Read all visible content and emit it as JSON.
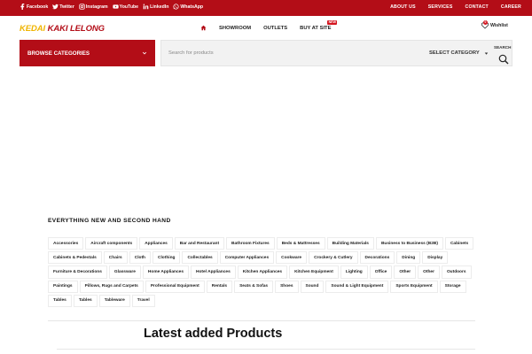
{
  "social": [
    {
      "label": "Facebook",
      "icon": "facebook-icon"
    },
    {
      "label": "Twitter",
      "icon": "twitter-icon"
    },
    {
      "label": "Instagram",
      "icon": "instagram-icon"
    },
    {
      "label": "YouTube",
      "icon": "youtube-icon"
    },
    {
      "label": "LinkedIn",
      "icon": "linkedin-icon"
    },
    {
      "label": "WhatsApp",
      "icon": "whatsapp-icon"
    }
  ],
  "top_links": [
    "ABOUT US",
    "SERVICES",
    "CONTACT",
    "CAREER"
  ],
  "logo": {
    "part1": "KEDAI",
    "part2": " KAKI LELONG"
  },
  "nav": {
    "showroom": "SHOWROOM",
    "outlets": "OUTLETS",
    "buy_at_site": "BUY AT SITE",
    "new_badge": "NEW"
  },
  "wishlist": {
    "label": "Wishlist",
    "count": "0"
  },
  "browse": {
    "label": "BROWSE CATEGORIES"
  },
  "search": {
    "placeholder": "Search for products",
    "category": "SELECT CATEGORY",
    "button_label": "SEARCH"
  },
  "section": {
    "heading": "EVERYTHING NEW AND SECOND HAND"
  },
  "tags": [
    "Accessories",
    "Aircraft components",
    "Appliances",
    "Bar and Restaurant",
    "Bathroom Fixtures",
    "Beds & Mattresses",
    "Building Materials",
    "Business to Business (B2B)",
    "Cabinets",
    "Cabinets & Pedestals",
    "Chairs",
    "Cloth",
    "Clothing",
    "Collectables",
    "Computer Appliances",
    "Cookware",
    "Crockery & Cutlery",
    "Decorations",
    "Dining",
    "Display",
    "Furniture & Decorations",
    "Glassware",
    "Home Appliances",
    "Hotel Appliances",
    "Kitchen Appliances",
    "Kitchen Equipment",
    "Lighting",
    "Office",
    "Other",
    "Other",
    "Outdoors",
    "Paintings",
    "Pillows, Rugs and Carpets",
    "Professional Equipment",
    "Rentals",
    "Seats & Sofas",
    "Shoes",
    "Sound",
    "Sound & Light Equipment",
    "Sports Equipment",
    "Storage",
    "Tables",
    "Tables",
    "Tableware",
    "Travel"
  ],
  "latest": {
    "title": "Latest added Products"
  },
  "colors": {
    "brand_red": "#b30d17",
    "logo_yellow": "#f0b400"
  }
}
